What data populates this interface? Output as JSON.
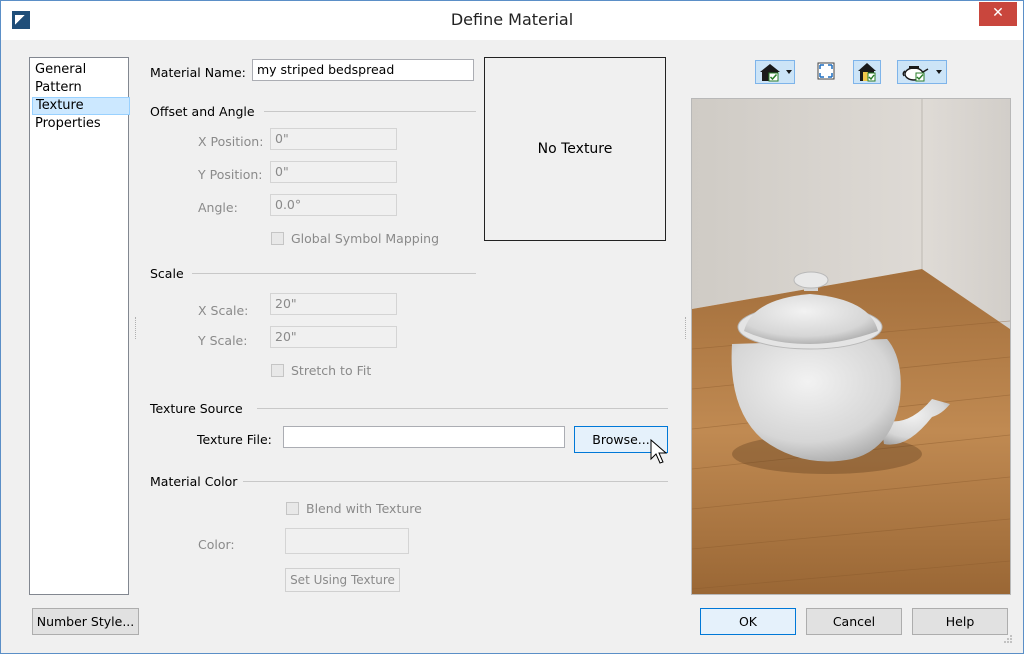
{
  "window": {
    "title": "Define Material",
    "close_glyph": "✕"
  },
  "nav": {
    "items": [
      {
        "label": "General",
        "selected": false
      },
      {
        "label": "Pattern",
        "selected": false
      },
      {
        "label": "Texture",
        "selected": true
      },
      {
        "label": "Properties",
        "selected": false
      }
    ]
  },
  "material_name": {
    "label": "Material Name:",
    "value": "my striped bedspread"
  },
  "offset_angle": {
    "heading": "Offset and Angle",
    "x_position": {
      "label": "X Position:",
      "value": "0\""
    },
    "y_position": {
      "label": "Y Position:",
      "value": "0\""
    },
    "angle": {
      "label": "Angle:",
      "value": "0.0°"
    },
    "global_mapping": {
      "label": "Global Symbol Mapping",
      "checked": false
    }
  },
  "scale": {
    "heading": "Scale",
    "x_scale": {
      "label": "X Scale:",
      "value": "20\""
    },
    "y_scale": {
      "label": "Y Scale:",
      "value": "20\""
    },
    "stretch_to_fit": {
      "label": "Stretch to Fit",
      "checked": false
    }
  },
  "texture_preview": {
    "text": "No Texture"
  },
  "texture_source": {
    "heading": "Texture Source",
    "file_label": "Texture File:",
    "file_value": "",
    "browse_label": "Browse..."
  },
  "material_color": {
    "heading": "Material Color",
    "blend": {
      "label": "Blend with Texture",
      "checked": false
    },
    "color_label": "Color:",
    "set_using_texture_label": "Set Using Texture"
  },
  "buttons": {
    "number_style": "Number Style...",
    "ok": "OK",
    "cancel": "Cancel",
    "help": "Help"
  },
  "preview_toolbar": [
    {
      "name": "house-view-dropdown-icon",
      "active": true
    },
    {
      "name": "fit-view-icon",
      "active": false
    },
    {
      "name": "lighting-toggle-icon",
      "active": true
    },
    {
      "name": "preview-object-dropdown-icon",
      "active": true
    }
  ],
  "colors": {
    "accent": "#0078d7",
    "selection": "#cce8ff",
    "close": "#c9463d",
    "floor": "#b07a43",
    "wall": "#d8d4cf"
  }
}
